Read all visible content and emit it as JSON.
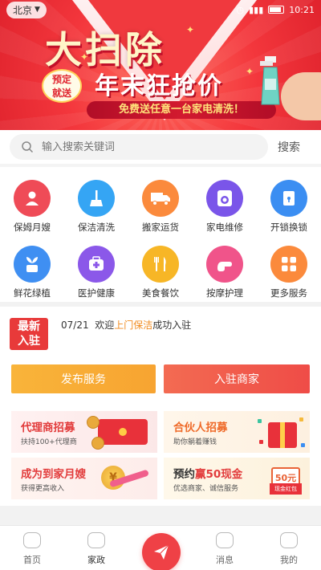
{
  "status_bar": {
    "city": "北京",
    "time": "10:21"
  },
  "banner": {
    "headline": "大扫除",
    "subline": "年末狂抢价",
    "badge_line1": "预定",
    "badge_line2": "就送",
    "promo": "免费送任意一台家电清洗！"
  },
  "search": {
    "placeholder": "输入搜索关键词",
    "button": "搜索"
  },
  "services": [
    {
      "label": "保姆月嫂",
      "color": "#ef4b57"
    },
    {
      "label": "保洁清洗",
      "color": "#35a5f4"
    },
    {
      "label": "搬家运货",
      "color": "#fb8a3c"
    },
    {
      "label": "家电维修",
      "color": "#7a55e9"
    },
    {
      "label": "开锁换锁",
      "color": "#3b8ef2"
    },
    {
      "label": "鲜花绿植",
      "color": "#3f8ff2"
    },
    {
      "label": "医护健康",
      "color": "#8b58e9"
    },
    {
      "label": "美食餐饮",
      "color": "#f7b626"
    },
    {
      "label": "按摩护理",
      "color": "#f0548a"
    },
    {
      "label": "更多服务",
      "color": "#fb8a3c"
    }
  ],
  "news": {
    "badge_line1": "最新",
    "badge_line2": "入驻",
    "date": "07/21",
    "prefix": "欢迎",
    "highlight": "上门保洁",
    "suffix": "成功入驻"
  },
  "actions": {
    "publish": "发布服务",
    "join": "入驻商家"
  },
  "cards": [
    {
      "title": "代理商招募",
      "sub": "扶持100+代理商",
      "title_color": "#e23c3c"
    },
    {
      "title": "合伙人招募",
      "sub": "助你躺着赚钱",
      "title_color": "#ef6b2a"
    },
    {
      "title": "成为到家月嫂",
      "sub": "获得更高收入",
      "title_color": "#e23c3c"
    },
    {
      "title_pre": "预约",
      "title_hl": "赢50现金",
      "sub": "优选商家、诚信服务",
      "title_color": "#333333",
      "hl_color": "#e23c3c",
      "money": "50元",
      "packet": "现金红包"
    }
  ],
  "tabbar": [
    {
      "label": "首页",
      "active": false
    },
    {
      "label": "家政",
      "active": true
    },
    {
      "label": "消息",
      "active": false
    },
    {
      "label": "我的",
      "active": false
    }
  ]
}
